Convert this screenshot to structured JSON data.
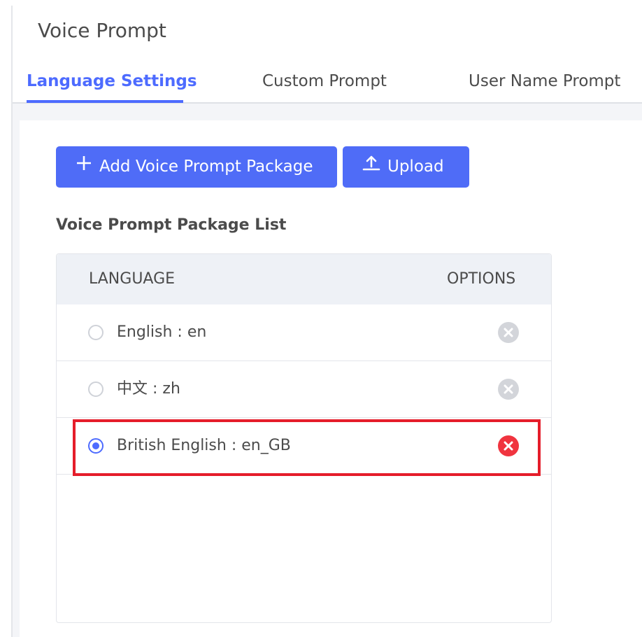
{
  "page": {
    "title": "Voice Prompt"
  },
  "tabs": [
    {
      "label": "Language Settings",
      "active": true
    },
    {
      "label": "Custom Prompt",
      "active": false
    },
    {
      "label": "User Name Prompt",
      "active": false
    }
  ],
  "toolbar": {
    "add_label": "Add Voice Prompt Package",
    "add_icon": "plus-icon",
    "upload_label": "Upload",
    "upload_icon": "upload-icon"
  },
  "section": {
    "title": "Voice Prompt Package List"
  },
  "table": {
    "columns": [
      "LANGUAGE",
      "OPTIONS"
    ],
    "rows": [
      {
        "label": "English : en",
        "selected": false,
        "delete_active": false
      },
      {
        "label": "中文 : zh",
        "selected": false,
        "delete_active": false
      },
      {
        "label": "British English : en_GB",
        "selected": true,
        "delete_active": true
      }
    ]
  },
  "colors": {
    "accent": "#4d6bff",
    "button": "#4f6cf7",
    "highlight": "#e51d2a",
    "delete_disabled": "#d3d5da",
    "delete_active": "#f0343f"
  }
}
